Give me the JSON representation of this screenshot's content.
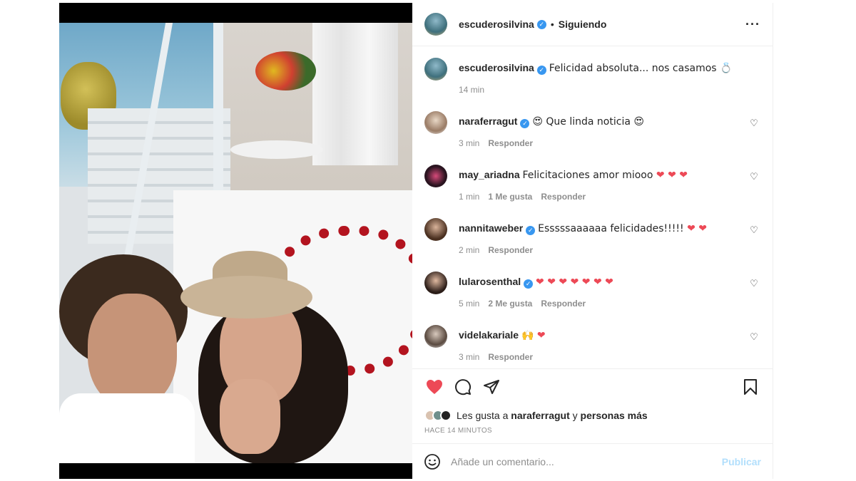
{
  "post": {
    "author": "escuderosilvina",
    "follow_status": "Siguiendo",
    "more_icon": "ellipsis-icon"
  },
  "caption": {
    "user": "escuderosilvina",
    "text": "Felicidad absoluta... nos casamos 💍",
    "time": "14 min"
  },
  "comments": [
    {
      "user": "naraferragut",
      "verified": true,
      "text": "😍 Que linda noticia 😍",
      "time": "3 min",
      "likes": "",
      "reply": "Responder"
    },
    {
      "user": "may_ariadna",
      "verified": false,
      "text": "Felicitaciones amor miooo ❤️ ❤️ ❤️",
      "time": "1 min",
      "likes": "1 Me gusta",
      "reply": "Responder"
    },
    {
      "user": "nannitaweber",
      "verified": true,
      "text": "Esssssaaaaaa felicidades!!!!! ❤️ ❤️",
      "time": "2 min",
      "likes": "",
      "reply": "Responder"
    },
    {
      "user": "lularosenthal",
      "verified": true,
      "text": "❤️ ❤️ ❤️ ❤️ ❤️ ❤️ ❤️",
      "time": "5 min",
      "likes": "2 Me gusta",
      "reply": "Responder"
    },
    {
      "user": "videlakariale",
      "verified": false,
      "text": "🙌 ❤️",
      "time": "3 min",
      "likes": "",
      "reply": "Responder"
    }
  ],
  "likes": {
    "prefix": "Les gusta a",
    "user": "naraferragut",
    "connector": "y",
    "suffix": "personas más"
  },
  "time_ago": "HACE 14 MINUTOS",
  "add_comment": {
    "placeholder": "Añade un comentario...",
    "publish": "Publicar"
  },
  "colors": {
    "verified": "#3897f0",
    "like_active": "#ed4956",
    "publish_disabled": "#b2dffc",
    "muted_text": "#8e8e8e"
  }
}
